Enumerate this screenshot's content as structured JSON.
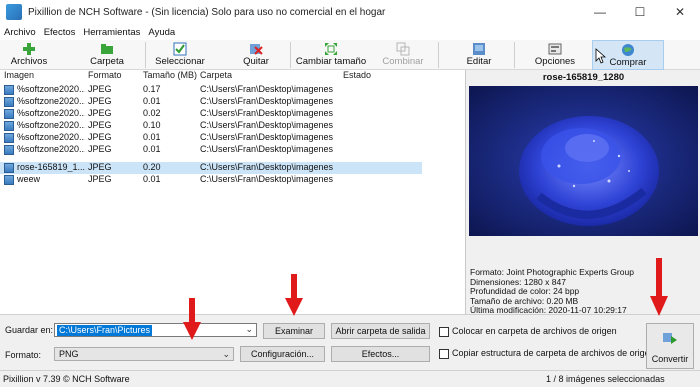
{
  "window": {
    "title": "Pixillion de NCH Software - (Sin licencia) Solo para uso no comercial en el hogar",
    "minimize_glyph": "—",
    "maximize_glyph": "☐",
    "close_glyph": "✕"
  },
  "menu": [
    "Archivo",
    "Efectos",
    "Herramientas",
    "Ayuda"
  ],
  "toolbar": {
    "archivos": "Archivos",
    "carpeta": "Carpeta",
    "seleccionar": "Seleccionar",
    "quitar": "Quitar",
    "cambiar_tamano": "Cambiar tamaño",
    "combinar": "Combinar",
    "editar": "Editar",
    "opciones": "Opciones",
    "comprar": "Comprar"
  },
  "list": {
    "headers": {
      "imagen": "Imagen",
      "formato": "Formato",
      "tamano": "Tamaño (MB)",
      "carpeta": "Carpeta",
      "estado": "Estado"
    },
    "rows": [
      {
        "name": "%softzone2020...",
        "format": "JPEG",
        "size": "0.17",
        "folder": "C:\\Users\\Fran\\Desktop\\imagenes"
      },
      {
        "name": "%softzone2020...",
        "format": "JPEG",
        "size": "0.01",
        "folder": "C:\\Users\\Fran\\Desktop\\imagenes"
      },
      {
        "name": "%softzone2020...",
        "format": "JPEG",
        "size": "0.02",
        "folder": "C:\\Users\\Fran\\Desktop\\imagenes"
      },
      {
        "name": "%softzone2020...",
        "format": "JPEG",
        "size": "0.10",
        "folder": "C:\\Users\\Fran\\Desktop\\imagenes"
      },
      {
        "name": "%softzone2020...",
        "format": "JPEG",
        "size": "0.01",
        "folder": "C:\\Users\\Fran\\Desktop\\imagenes"
      },
      {
        "name": "%softzone2020...",
        "format": "JPEG",
        "size": "0.01",
        "folder": "C:\\Users\\Fran\\Desktop\\imagenes"
      },
      {
        "name": "rose-165819_1...",
        "format": "JPEG",
        "size": "0.20",
        "folder": "C:\\Users\\Fran\\Desktop\\imagenes",
        "selected": true
      },
      {
        "name": "weew",
        "format": "JPEG",
        "size": "0.01",
        "folder": "C:\\Users\\Fran\\Desktop\\imagenes"
      }
    ]
  },
  "preview": {
    "title": "rose-165819_1280",
    "info": {
      "formato": "Formato: Joint Photographic Experts Group",
      "dimensiones": "Dimensiones: 1280 x 847",
      "profundidad": "Profundidad de color: 24 bpp",
      "tamano": "Tamaño de archivo: 0.20 MB",
      "modificacion": "Última modificación: 2020-11-07 10:29:17"
    }
  },
  "bottom": {
    "guardar_en_label": "Guardar en:",
    "guardar_en_value": "C:\\Users\\Fran\\Pictures",
    "formato_label": "Formato:",
    "formato_value": "PNG",
    "examinar": "Examinar",
    "abrir_carpeta": "Abrir carpeta de salida",
    "configuracion": "Configuración...",
    "efectos": "Efectos...",
    "colocar_origen": "Colocar en carpeta de archivos de origen",
    "copiar_estructura": "Copiar estructura de carpeta de archivos de origen",
    "convertir": "Convertir"
  },
  "status": {
    "version": "Pixillion v 7.39 © NCH Software",
    "selection": "1 / 8 imágenes seleccionadas"
  },
  "colors": {
    "accent": "#0078d7",
    "selected_row": "#cce4f7",
    "annotation_arrow": "#e0191b"
  }
}
